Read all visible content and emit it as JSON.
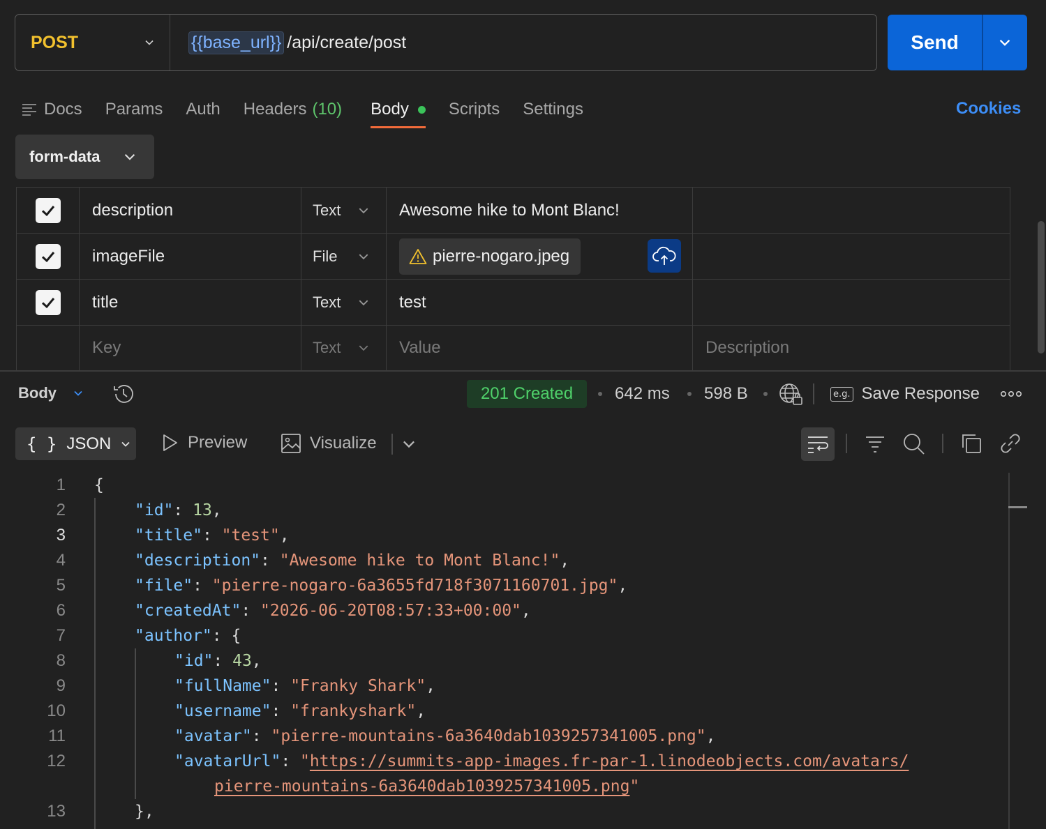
{
  "request": {
    "method": "POST",
    "url_variable": "{{base_url}}",
    "url_path": "/api/create/post",
    "send_label": "Send"
  },
  "tabs": {
    "docs": "Docs",
    "params": "Params",
    "auth": "Auth",
    "headers": "Headers",
    "headers_count": "(10)",
    "body": "Body",
    "scripts": "Scripts",
    "settings": "Settings",
    "cookies": "Cookies"
  },
  "body_mode": "form-data",
  "form_rows": [
    {
      "key": "description",
      "type": "Text",
      "value": "Awesome hike to Mont Blanc!",
      "checked": true
    },
    {
      "key": "imageFile",
      "type": "File",
      "value": "pierre-nogaro.jpeg",
      "checked": true
    },
    {
      "key": "title",
      "type": "Text",
      "value": "test",
      "checked": true
    }
  ],
  "form_placeholders": {
    "key": "Key",
    "type": "Text",
    "value": "Value",
    "description": "Description"
  },
  "response": {
    "label": "Body",
    "status": "201 Created",
    "time": "642 ms",
    "size": "598 B",
    "save_label": "Save Response",
    "eg_label": "e.g.",
    "format": "JSON",
    "braces": "{ }",
    "preview": "Preview",
    "visualize": "Visualize"
  },
  "code": {
    "line_numbers": [
      "1",
      "2",
      "3",
      "4",
      "5",
      "6",
      "7",
      "8",
      "9",
      "10",
      "11",
      "12",
      "",
      "13"
    ],
    "lines": {
      "l1": "{",
      "l2k": "\"id\"",
      "l2v": "13",
      "l3k": "\"title\"",
      "l3v": "\"test\"",
      "l4k": "\"description\"",
      "l4v": "\"Awesome hike to Mont Blanc!\"",
      "l5k": "\"file\"",
      "l5v": "\"pierre-nogaro-6a3655fd718f3071160701.jpg\"",
      "l6k": "\"createdAt\"",
      "l6v": "\"2026-06-20T08:57:33+00:00\"",
      "l7k": "\"author\"",
      "l7v": "{",
      "l8k": "\"id\"",
      "l8v": "43",
      "l9k": "\"fullName\"",
      "l9v": "\"Franky Shark\"",
      "l10k": "\"username\"",
      "l10v": "\"frankyshark\"",
      "l11k": "\"avatar\"",
      "l11v": "\"pierre-mountains-6a3640dab1039257341005.png\"",
      "l12k": "\"avatarUrl\"",
      "l12q": "\"",
      "l12v": "https://summits-app-images.fr-par-1.linodeobjects.com/avatars/",
      "l12cont": "pierre-mountains-6a3640dab1039257341005.png",
      "l12end": "\"",
      "l13": "},"
    }
  },
  "colors": {
    "accent_send": "#0b65d8",
    "method": "#f2c12e",
    "status_ok": "#4fd16a",
    "json_key": "#7cc3ff",
    "json_string": "#e5957a",
    "json_number": "#b8d7a3",
    "tab_underline": "#f26b3a"
  }
}
